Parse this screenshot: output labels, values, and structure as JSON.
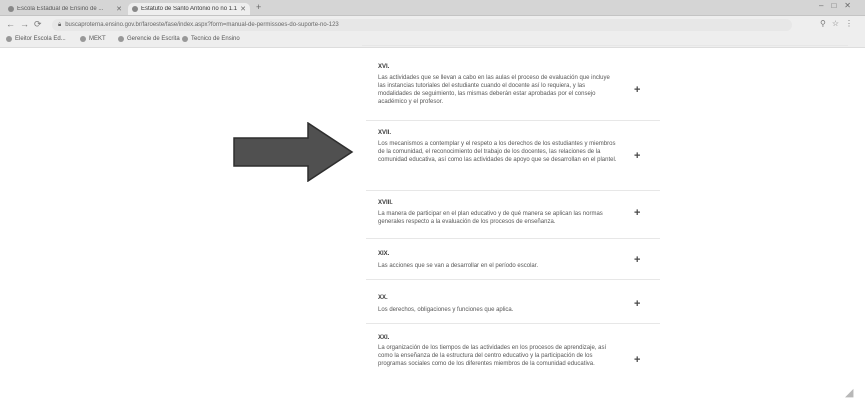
{
  "browser": {
    "tabs": [
      {
        "title": "Escola Estadual de Ensino de ...",
        "active": false
      },
      {
        "title": "Estatuto de Santo Antonio no no 1.1 ...",
        "active": true
      }
    ],
    "address": "buscaproterna.ensino.gov.br/faroeste/fase/index.aspx?form=manual-de-permissoes-do-suporte-no-123",
    "bookmarks": [
      "Eleitor Escola Ed...",
      "MEKT",
      "Gerencie de Escrita",
      "Tecnico de Ensino"
    ]
  },
  "sections": [
    {
      "title": "XVI.",
      "text": "Las actividades que se llevan a cabo en las aulas el proceso de evaluación que incluye las instancias tutoriales del estudiante cuando el docente así lo requiera, y las modalidades de seguimiento, las mismas deberán estar aprobadas por el consejo académico y el profesor."
    },
    {
      "title": "XVII.",
      "text": "Los mecanismos a contemplar y el respeto a los derechos de los estudiantes y miembros de la comunidad, el reconocimiento del trabajo de los docentes, las relaciones de la comunidad educativa, así como las actividades de apoyo que se desarrollan en el plantel."
    },
    {
      "title": "XVIII.",
      "text": "La manera de participar en el plan educativo y de qué manera se aplican las normas generales respecto a la evaluación de los procesos de enseñanza."
    },
    {
      "title": "XIX.",
      "text": "Las acciones que se van a desarrollar en el período escolar."
    },
    {
      "title": "XX.",
      "text": "Los derechos, obligaciones y funciones que aplica."
    },
    {
      "title": "XXI.",
      "text": "La organización de los tiempos de las actividades en los procesos de aprendizaje, así como la enseñanza de la estructura del centro educativo y la participación de los programas sociales como de los diferentes miembros de la comunidad educativa."
    }
  ],
  "colors": {
    "arrow": "#4d4d4d",
    "arrow_outline": "#2a2a2a"
  }
}
